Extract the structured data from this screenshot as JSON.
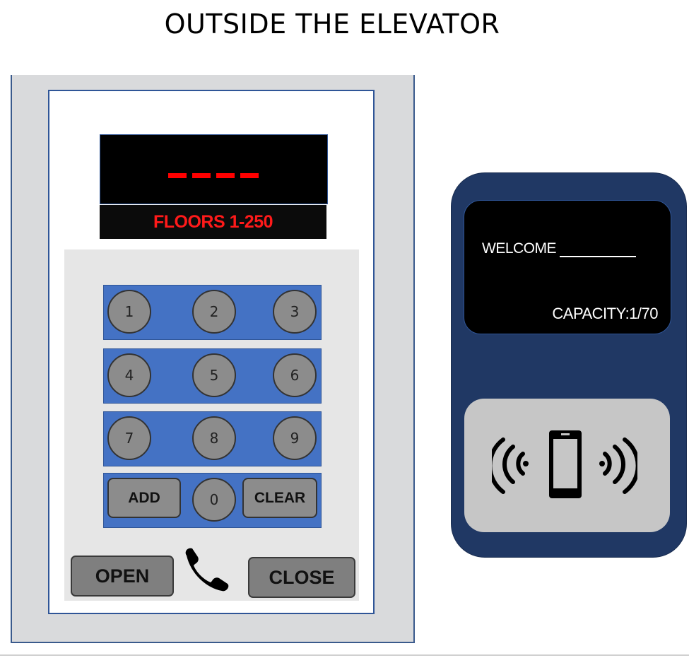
{
  "page": {
    "title": "OUTSIDE THE ELEVATOR"
  },
  "panel": {
    "floors_label": "FLOORS 1-250",
    "keys": {
      "row1": [
        "1",
        "2",
        "3"
      ],
      "row2": [
        "4",
        "5",
        "6"
      ],
      "row3": [
        "7",
        "8",
        "9"
      ]
    },
    "add_label": "ADD",
    "zero_label": "0",
    "clear_label": "CLEAR",
    "open_label": "OPEN",
    "close_label": "CLOSE",
    "display_color": "#ff0000",
    "keypad_color": "#4472c4"
  },
  "reader": {
    "welcome_label": "WELCOME",
    "capacity_label": "CAPACITY:1/70",
    "body_color": "#203864"
  },
  "icons": {
    "phone": "phone-icon",
    "nfc": "nfc-phone-icon"
  }
}
